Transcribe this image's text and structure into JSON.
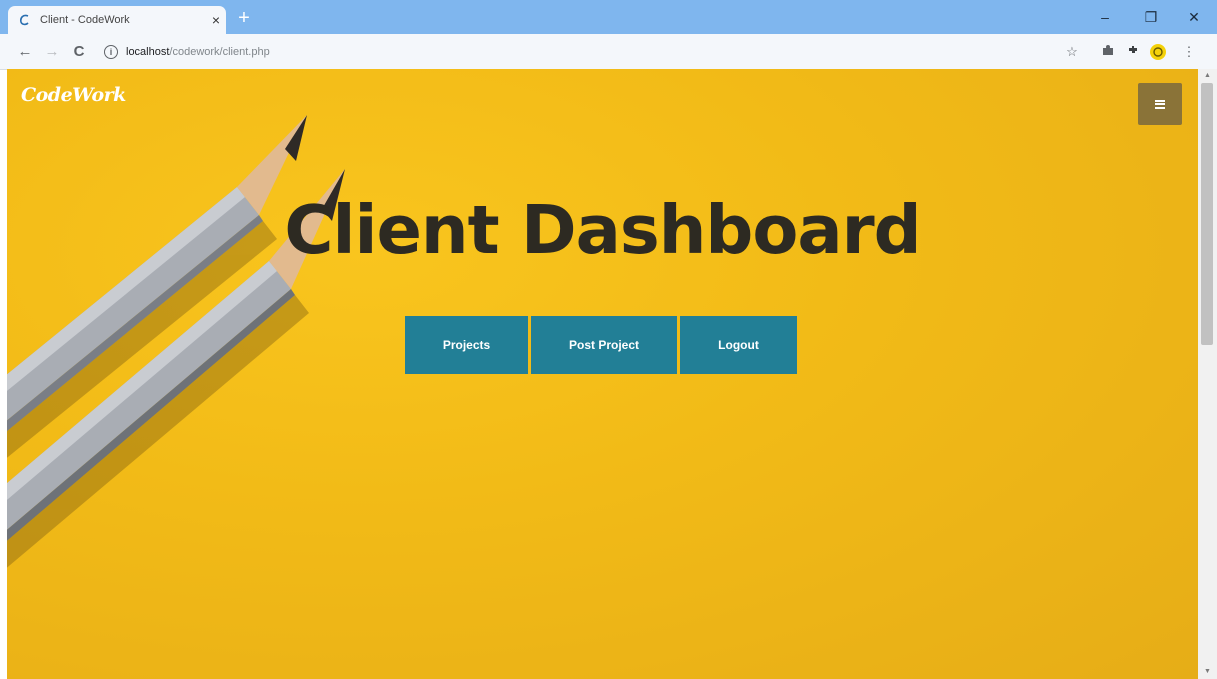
{
  "browser": {
    "tab_title": "Client - CodeWork",
    "tab_close": "×",
    "new_tab": "+",
    "url_host": "localhost",
    "url_path": "/codework/client.php",
    "window_controls": {
      "minimize": "–",
      "maximize": "❐",
      "close": "✕"
    },
    "nav": {
      "back": "←",
      "forward": "→",
      "reload": "C"
    }
  },
  "site": {
    "brand": "CodeWork",
    "hero_title": "Client Dashboard",
    "buttons": [
      {
        "label": "Projects"
      },
      {
        "label": "Post Project"
      },
      {
        "label": "Logout"
      }
    ]
  },
  "icons": {
    "menu": "hamburger-icon",
    "info": "info-icon",
    "star": "star-icon",
    "extension": "puzzle-icon",
    "profile": "profile-icon"
  },
  "colors": {
    "background": "#f2bb17",
    "button": "#227f96",
    "menu_button": "#8a7338",
    "title_text": "#2d2a22",
    "tabbar": "#7fb6ee"
  }
}
